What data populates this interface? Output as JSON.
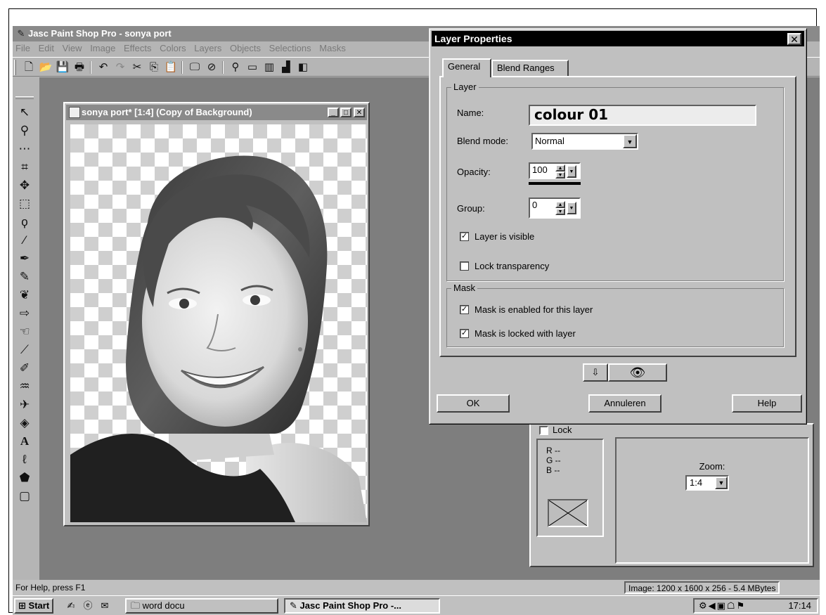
{
  "app": {
    "title": "Jasc Paint Shop Pro - sonya port",
    "menu": [
      "File",
      "Edit",
      "View",
      "Image",
      "Effects",
      "Colors",
      "Layers",
      "Objects",
      "Selections",
      "Masks"
    ]
  },
  "image_window": {
    "title": "sonya port* [1:4] (Copy of Background)"
  },
  "overview": {
    "lock_label": "Lock",
    "rgb_r": "R  --",
    "rgb_g": "G  --",
    "rgb_b": "B  --",
    "zoom_label": "Zoom:",
    "zoom_value": "1:4"
  },
  "status": {
    "help_text": "For Help, press F1",
    "image_info": "Image:  1200 x 1600 x 256 - 5.4 MBytes"
  },
  "taskbar": {
    "start_label": "Start",
    "tasks": [
      "word docu",
      "Jasc Paint Shop Pro -..."
    ],
    "clock": "17:14"
  },
  "dialog": {
    "title": "Layer Properties",
    "tabs": [
      "General",
      "Blend Ranges"
    ],
    "layer_group_label": "Layer",
    "name_label": "Name:",
    "name_value": "colour 01",
    "blend_mode_label": "Blend mode:",
    "blend_mode_value": "Normal",
    "opacity_label": "Opacity:",
    "opacity_value": "100",
    "group_label": "Group:",
    "group_value": "0",
    "layer_visible_label": "Layer is visible",
    "layer_visible_checked": true,
    "lock_transparency_label": "Lock transparency",
    "lock_transparency_checked": false,
    "mask_group_label": "Mask",
    "mask_enabled_label": "Mask is enabled for this layer",
    "mask_enabled_checked": true,
    "mask_locked_label": "Mask is locked with layer",
    "mask_locked_checked": true,
    "ok_label": "OK",
    "cancel_label": "Annuleren",
    "help_label": "Help"
  }
}
